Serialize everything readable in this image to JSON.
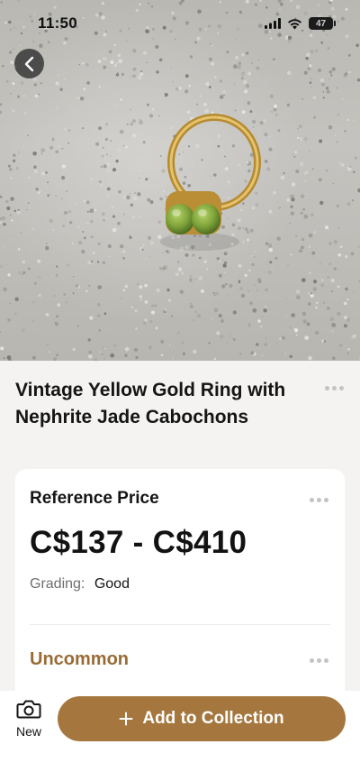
{
  "status_bar": {
    "time": "11:50",
    "battery": "47"
  },
  "hero": {
    "back_icon": "chevron-left-icon"
  },
  "item": {
    "title": "Vintage Yellow Gold Ring with Nephrite Jade Cabochons",
    "more_icon": "more-horizontal-icon"
  },
  "price_card": {
    "label": "Reference Price",
    "range": "C$137 - C$410",
    "grading_label": "Grading:",
    "grading_value": "Good",
    "rarity": "Uncommon"
  },
  "bottom_bar": {
    "new_label": "New",
    "new_icon": "camera-icon",
    "add_label": "Add to Collection",
    "add_icon": "plus-icon"
  },
  "colors": {
    "accent": "#a5773e",
    "rarity": "#9a6b35",
    "background": "#f4f3f1"
  }
}
